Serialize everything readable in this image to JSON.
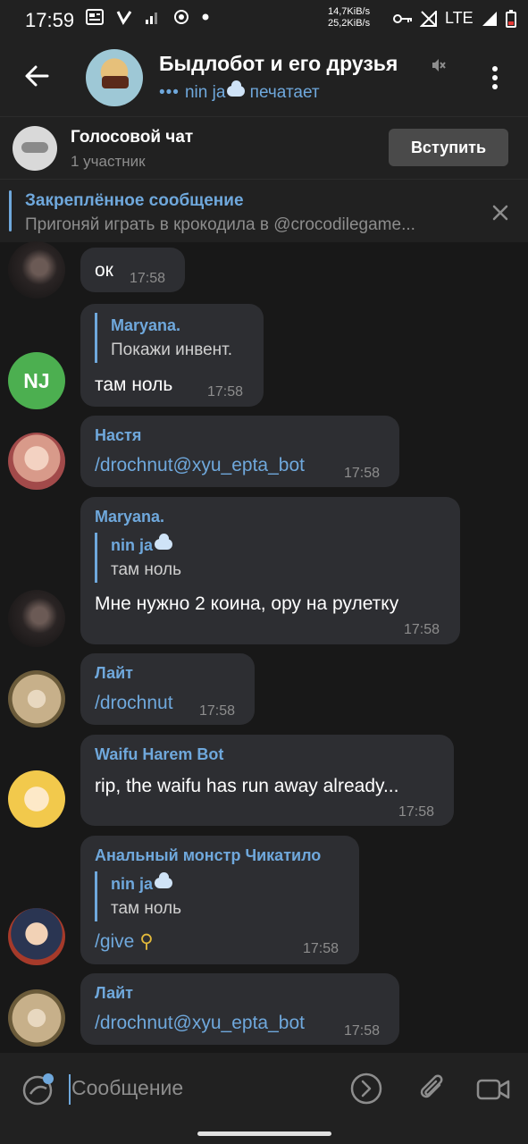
{
  "status_bar": {
    "time": "17:59",
    "speed_up": "14,7KiB/s",
    "speed_down": "25,2KiB/s",
    "network": "LTE"
  },
  "header": {
    "title": "Быдлобот и его друзья",
    "typing_user": "nin ja",
    "typing_text": "печатает"
  },
  "voice_chat": {
    "title": "Голосовой чат",
    "participants": "1 участник",
    "join_label": "Вступить"
  },
  "pinned": {
    "title": "Закреплённое сообщение",
    "text": "Пригоняй играть в крокодила в @crocodilegame..."
  },
  "messages": [
    {
      "text": "ок",
      "time": "17:58"
    },
    {
      "avatar_initials": "NJ",
      "reply_name": "Maryana.",
      "reply_text": "Покажи инвент.",
      "text": "там ноль",
      "time": "17:58"
    },
    {
      "sender": "Настя",
      "text": "/drochnut@xyu_epta_bot",
      "time": "17:58"
    },
    {
      "sender": "Maryana.",
      "reply_name": "nin ja",
      "reply_text": "там ноль",
      "text": "Мне нужно 2 коина, ору на рулетку",
      "time": "17:58"
    },
    {
      "sender": "Лайт",
      "text": "/drochnut",
      "time": "17:58"
    },
    {
      "sender": "Waifu Harem Bot",
      "text": "rip, the waifu has run away already...",
      "time": "17:58"
    },
    {
      "sender": "Анальный монстр Чикатило",
      "reply_name": "nin ja",
      "reply_text": "там ноль",
      "text": "/give",
      "time": "17:58"
    },
    {
      "sender": "Лайт",
      "text": "/drochnut@xyu_epta_bot",
      "time": "17:58"
    }
  ],
  "input": {
    "placeholder": "Сообщение"
  },
  "icons": {
    "back": "arrow-left-icon",
    "mute": "muted-speaker-icon",
    "menu": "more-vertical-icon",
    "close": "close-icon",
    "emoji": "emoji-sticker-icon",
    "commands": "bot-commands-icon",
    "attach": "paperclip-icon",
    "video": "video-message-icon"
  },
  "colors": {
    "accent": "#6fa8dc",
    "background": "#181818",
    "bubble": "#2d2e32",
    "bar": "#212121"
  }
}
